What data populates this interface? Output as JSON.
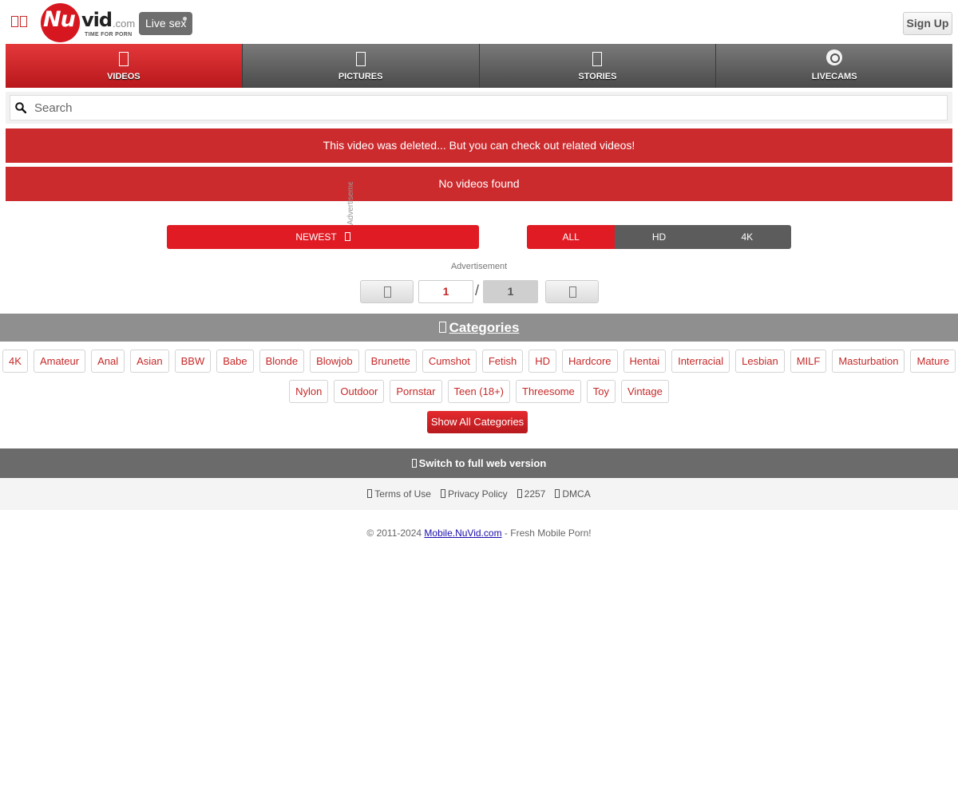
{
  "header": {
    "logo": {
      "nu": "Nu",
      "vid": "vid",
      "com": ".com",
      "tagline": "TIME FOR PORN"
    },
    "live_label": "Live sex",
    "signup_label": "Sign Up"
  },
  "nav": {
    "items": [
      {
        "label": "VIDEOS",
        "icon": "video-icon",
        "active": true
      },
      {
        "label": "PICTURES",
        "icon": "picture-icon",
        "active": false
      },
      {
        "label": "STORIES",
        "icon": "book-icon",
        "active": false
      },
      {
        "label": "LIVECAMS",
        "icon": "webcam-icon",
        "active": false
      }
    ]
  },
  "search": {
    "placeholder": "Search",
    "value": ""
  },
  "alerts": {
    "deleted": "This video was deleted... But you can check out related videos!",
    "none_found": "No videos found"
  },
  "ad_vertical_label": "Advertisement",
  "filters": {
    "sort_label": "NEWEST",
    "quality": [
      {
        "label": "ALL",
        "active": true
      },
      {
        "label": "HD",
        "active": false
      },
      {
        "label": "4K",
        "active": false
      }
    ]
  },
  "ad_label": "Advertisement",
  "pagination": {
    "current": "1",
    "separator": "/",
    "total": "1"
  },
  "categories": {
    "title": "Categories",
    "row1": [
      "4K",
      "Amateur",
      "Anal",
      "Asian",
      "BBW",
      "Babe",
      "Blonde",
      "Blowjob",
      "Brunette",
      "Cumshot",
      "Fetish",
      "HD",
      "Hardcore",
      "Hentai",
      "Interracial",
      "Lesbian",
      "MILF",
      "Masturbation",
      "Mature"
    ],
    "row2": [
      "Nylon",
      "Outdoor",
      "Pornstar",
      "Teen (18+)",
      "Threesome",
      "Toy",
      "Vintage"
    ],
    "show_all": "Show All Categories"
  },
  "footer": {
    "full_web": "Switch to full web version",
    "links": [
      "Terms of Use",
      "Privacy Policy",
      "2257",
      "DMCA"
    ],
    "copyright_prefix": "© 2011-2024",
    "copyright_link": "Mobile.NuVid.com",
    "copyright_suffix": "- Fresh Mobile Porn!"
  },
  "colors": {
    "brand_red": "#e01b24",
    "dark_gray": "#5c5c5c",
    "category_text": "#c62828"
  }
}
